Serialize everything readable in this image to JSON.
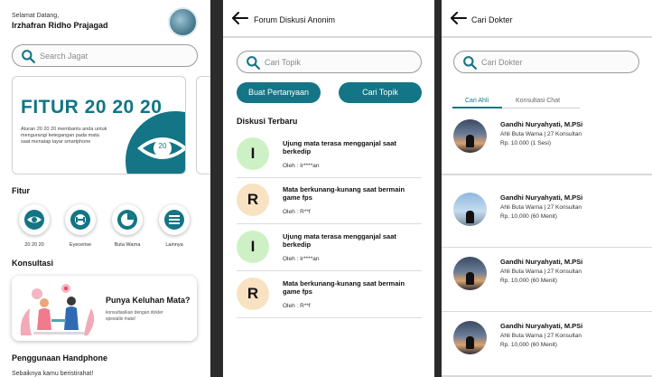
{
  "home": {
    "greeting": "Selamat Datang,",
    "user_name": "Irzhafran Ridho Prajagad",
    "search_placeholder": "Search Jagat",
    "banner_title": "FITUR 20 20 20",
    "banner_desc": "Aturan 20 20 20 membantu anda untuk mengurangi ketegangan pada mata saat menatap layar smartphone",
    "banner_number": "20",
    "fitur_heading": "Fitur",
    "fitur_items": [
      {
        "label": "20 20 20",
        "icon": "eye-20-icon"
      },
      {
        "label": "Eyecerise",
        "icon": "dumbbell-icon"
      },
      {
        "label": "Buta Warna",
        "icon": "color-disk-icon"
      },
      {
        "label": "Lainnya",
        "icon": "menu-icon"
      }
    ],
    "konsultasi_heading": "Konsultasi",
    "konsultasi_title": "Punya Keluhan Mata?",
    "konsultasi_desc": "konsultasikan dengan dokter spesialis mata!",
    "penggunaan_heading": "Penggunaan Handphone",
    "cut_text": "Sebaiknya kamu beristirahat!"
  },
  "forum": {
    "title": "Forum Diskusi Anonim",
    "search_placeholder": "Cari Topik",
    "btn_ask": "Buat Pertanyaan",
    "btn_search": "Cari Topik",
    "section": "Diskusi Terbaru",
    "items": [
      {
        "letter": "I",
        "title": "Ujung mata terasa mengganjal saat berkedip",
        "by": "Oleh : Ir****an"
      },
      {
        "letter": "R",
        "title": "Mata berkunang-kunang saat bermain game fps",
        "by": "Oleh : R**f"
      },
      {
        "letter": "I",
        "title": "Ujung mata terasa mengganjal saat berkedip",
        "by": "Oleh : Ir****an"
      },
      {
        "letter": "R",
        "title": "Mata berkunang-kunang saat bermain game fps",
        "by": "Oleh : R**f"
      }
    ]
  },
  "doctor": {
    "title": "Cari Dokter",
    "search_placeholder": "Cari Dokter",
    "tab_active": "Cari Ahli",
    "tab_other": "Konsultasi Chat",
    "doctors": [
      {
        "name": "Gandhi Nuryahyati, M.PSi",
        "spec": "Ahli Buta Warna | 27 Konsultan",
        "price": "Rp. 10.000 (1 Sesi)"
      },
      {
        "name": "Gandhi Nuryahyati, M.PSi",
        "spec": "Ahli Buta Warna | 27 Konsultan",
        "price": "Rp. 10,000 (60 Menit)"
      },
      {
        "name": "Gandhi Nuryahyati, M.PSi",
        "spec": "Ahli Buta Warna | 27 Konsultan",
        "price": "Rp. 10,000 (60 Menit)"
      },
      {
        "name": "Gandhi Nuryahyati, M.PSi",
        "spec": "Ahli Buta Warna | 27 Konsultan",
        "price": "Rp. 10,000 (60 Menit)"
      }
    ]
  },
  "colors": {
    "accent": "#137585",
    "badge_i": "#cdf1c4",
    "badge_r": "#f8e2c2"
  }
}
